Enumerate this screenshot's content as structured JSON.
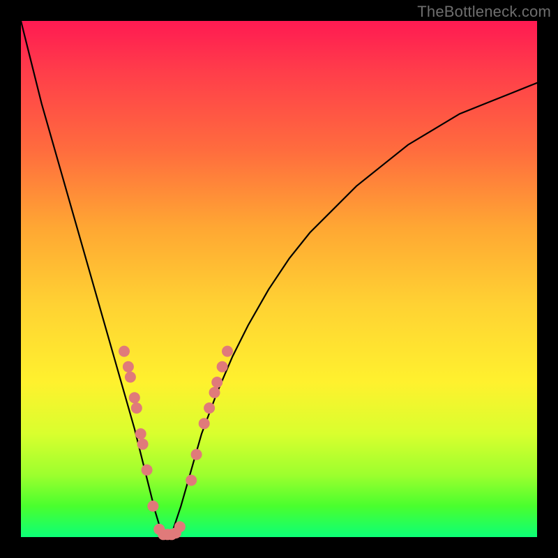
{
  "watermark": {
    "text": "TheBottleneck.com"
  },
  "colors": {
    "curve": "#000000",
    "marker_fill": "#e07a7a",
    "marker_stroke": "#c85a5a"
  },
  "plot": {
    "x_range": [
      0,
      100
    ],
    "y_range": [
      0,
      100
    ],
    "minimum_x": 27.5
  },
  "chart_data": {
    "type": "line",
    "title": "",
    "xlabel": "",
    "ylabel": "",
    "xlim": [
      0,
      100
    ],
    "ylim": [
      0,
      100
    ],
    "series": [
      {
        "name": "bottleneck-curve",
        "x": [
          0,
          2,
          4,
          6,
          8,
          10,
          12,
          14,
          16,
          18,
          20,
          22,
          24,
          26,
          27.5,
          29,
          31,
          33,
          35,
          38,
          41,
          44,
          48,
          52,
          56,
          60,
          65,
          70,
          75,
          80,
          85,
          90,
          95,
          100
        ],
        "y": [
          100,
          92,
          84,
          77,
          70,
          63,
          56,
          49,
          42,
          35,
          28,
          21,
          13,
          5,
          0,
          0,
          6,
          13,
          20,
          28,
          35,
          41,
          48,
          54,
          59,
          63,
          68,
          72,
          76,
          79,
          82,
          84,
          86,
          88
        ]
      }
    ],
    "markers": {
      "name": "data-points",
      "approximate": true,
      "points": [
        {
          "x": 20.0,
          "y": 36
        },
        {
          "x": 20.8,
          "y": 33
        },
        {
          "x": 21.2,
          "y": 31
        },
        {
          "x": 22.0,
          "y": 27
        },
        {
          "x": 22.4,
          "y": 25
        },
        {
          "x": 23.2,
          "y": 20
        },
        {
          "x": 23.6,
          "y": 18
        },
        {
          "x": 24.4,
          "y": 13
        },
        {
          "x": 25.6,
          "y": 6
        },
        {
          "x": 26.8,
          "y": 1.5
        },
        {
          "x": 27.6,
          "y": 0.5
        },
        {
          "x": 28.4,
          "y": 0.5
        },
        {
          "x": 29.2,
          "y": 0.5
        },
        {
          "x": 30.0,
          "y": 0.8
        },
        {
          "x": 30.8,
          "y": 2
        },
        {
          "x": 33.0,
          "y": 11
        },
        {
          "x": 34.0,
          "y": 16
        },
        {
          "x": 35.5,
          "y": 22
        },
        {
          "x": 36.5,
          "y": 25
        },
        {
          "x": 37.5,
          "y": 28
        },
        {
          "x": 38.0,
          "y": 30
        },
        {
          "x": 39.0,
          "y": 33
        },
        {
          "x": 40.0,
          "y": 36
        }
      ]
    }
  }
}
